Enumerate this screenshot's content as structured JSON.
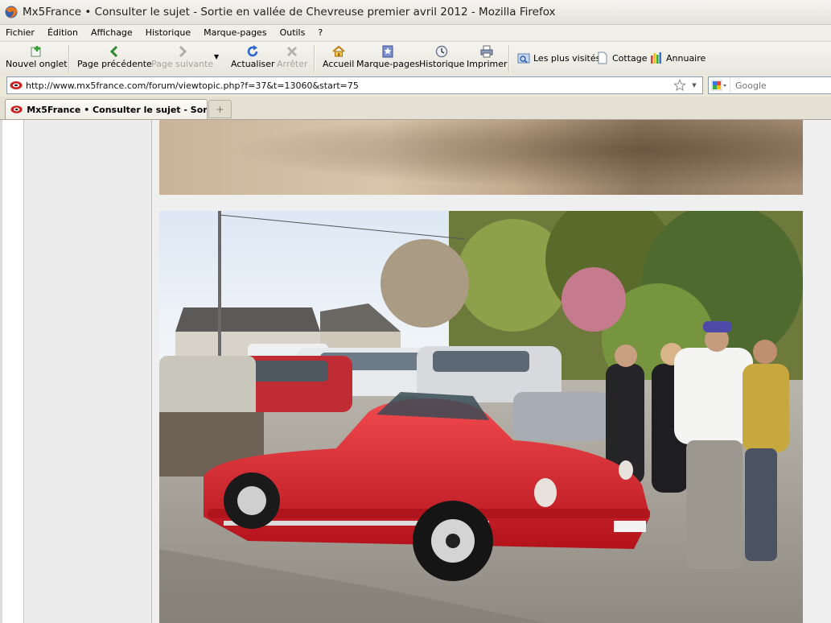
{
  "window": {
    "title": "Mx5France • Consulter le sujet - Sortie en vallée de Chevreuse premier avril 2012 - Mozilla Firefox"
  },
  "menu": {
    "items": [
      "Fichier",
      "Édition",
      "Affichage",
      "Historique",
      "Marque-pages",
      "Outils",
      "?"
    ]
  },
  "toolbar": {
    "new_tab": "Nouvel onglet",
    "back": "Page précédente",
    "forward": "Page suivante",
    "reload": "Actualiser",
    "stop": "Arrêter",
    "home": "Accueil",
    "bookmarks": "Marque-pages",
    "history": "Historique",
    "print": "Imprimer"
  },
  "bookmarks_bar": {
    "items": [
      "Les plus visités",
      "Cottage",
      "Annuaire"
    ]
  },
  "address_bar": {
    "url": "http://www.mx5france.com/forum/viewtopic.php?f=37&t=13060&start=75"
  },
  "search": {
    "placeholder": "Google"
  },
  "tabs": [
    {
      "label": "Mx5France • Consulter le sujet - Sor..."
    }
  ],
  "colors": {
    "accent": "#3a6ea5",
    "car_red": "#d81f2a"
  }
}
